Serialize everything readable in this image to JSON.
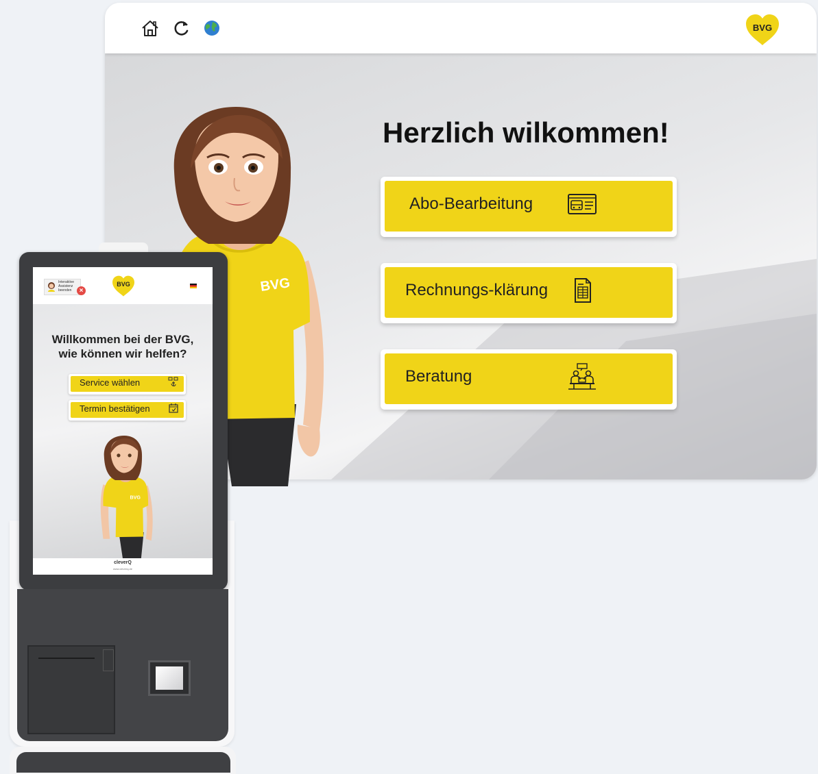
{
  "window": {
    "toolbar": {
      "home_icon": "home-icon",
      "reload_icon": "reload-icon",
      "globe_icon": "globe-icon",
      "logo_text": "BVG"
    },
    "welcome_title": "Herzlich wilkommen!",
    "buttons": [
      {
        "label": "Abo-Bearbeitung",
        "icon": "bus-ticket-icon"
      },
      {
        "label": "Rechnungs-klärung",
        "icon": "invoice-icon"
      },
      {
        "label": "Beratung",
        "icon": "consultation-icon"
      }
    ],
    "avatar_shirt_text": "BVG"
  },
  "kiosk": {
    "assist_text": "Interaktive Assistenz beenden",
    "logo_text": "BVG",
    "title_line1": "Willkommen bei der BVG,",
    "title_line2": "wie können wir helfen?",
    "buttons": [
      {
        "label": "Service wählen",
        "icon": "touch-select-icon"
      },
      {
        "label": "Termin bestätigen",
        "icon": "calendar-icon"
      }
    ],
    "shirt_text": "BVG",
    "footer_logo": "cleverQ",
    "footer_url": "www.cleverq.de"
  },
  "colors": {
    "brand_yellow": "#f0d418",
    "kiosk_dark": "#3c3d40",
    "close_red": "#e44a45"
  }
}
